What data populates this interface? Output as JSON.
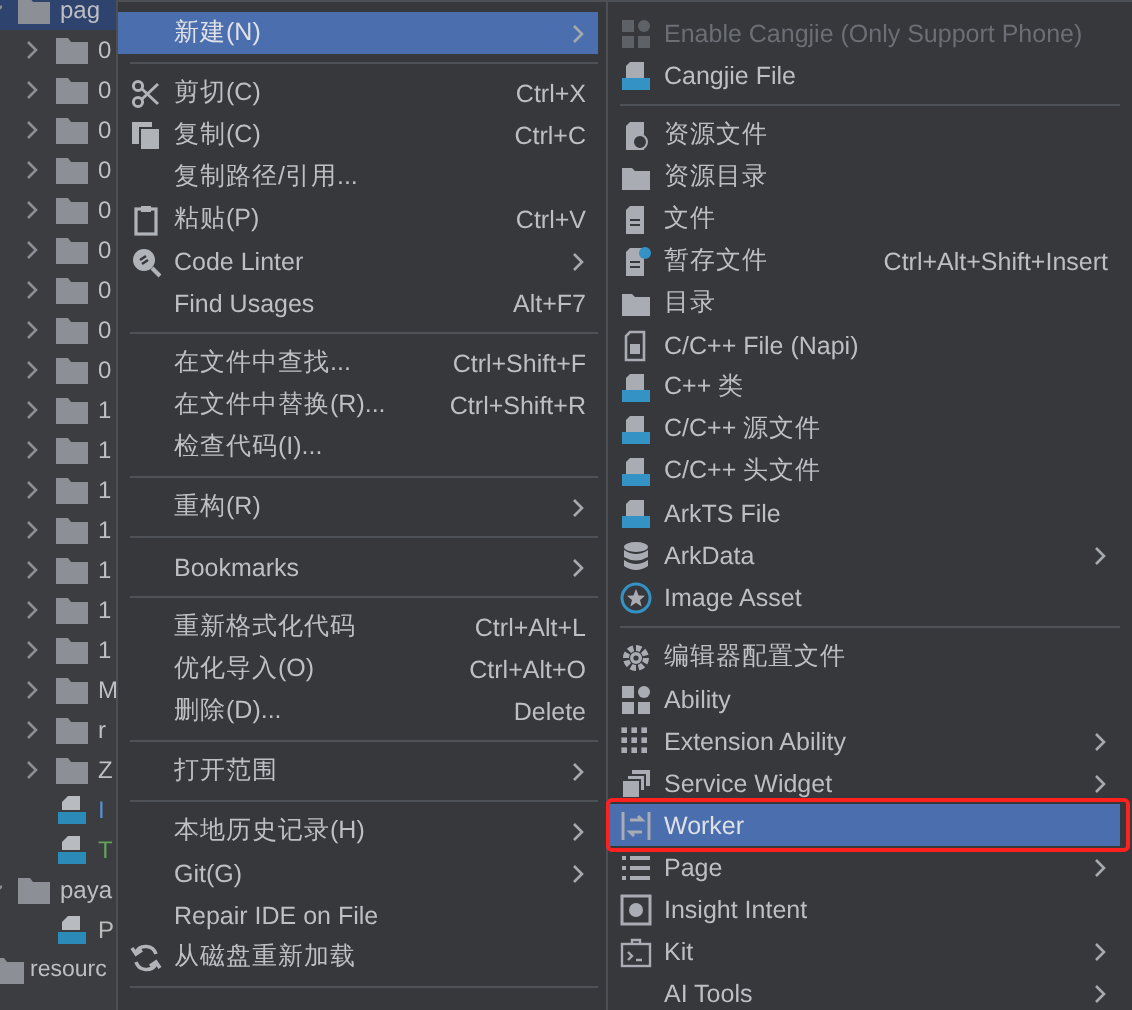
{
  "tree": {
    "items": [
      {
        "kind": "folder",
        "label": "pag",
        "expanded": true,
        "selected": true,
        "children": [
          {
            "kind": "folder",
            "label": "0",
            "expanded": false,
            "selected": false
          },
          {
            "kind": "folder",
            "label": "0",
            "expanded": false,
            "selected": false
          },
          {
            "kind": "folder",
            "label": "0",
            "expanded": false,
            "selected": false
          },
          {
            "kind": "folder",
            "label": "0",
            "expanded": false,
            "selected": false
          },
          {
            "kind": "folder",
            "label": "0",
            "expanded": false,
            "selected": false
          },
          {
            "kind": "folder",
            "label": "0",
            "expanded": false,
            "selected": false
          },
          {
            "kind": "folder",
            "label": "0",
            "expanded": false,
            "selected": false
          },
          {
            "kind": "folder",
            "label": "0",
            "expanded": false,
            "selected": false
          },
          {
            "kind": "folder",
            "label": "0",
            "expanded": false,
            "selected": false
          },
          {
            "kind": "folder",
            "label": "1",
            "expanded": false,
            "selected": false
          },
          {
            "kind": "folder",
            "label": "1",
            "expanded": false,
            "selected": false
          },
          {
            "kind": "folder",
            "label": "1",
            "expanded": false,
            "selected": false
          },
          {
            "kind": "folder",
            "label": "1",
            "expanded": false,
            "selected": false
          },
          {
            "kind": "folder",
            "label": "1",
            "expanded": false,
            "selected": false
          },
          {
            "kind": "folder",
            "label": "1",
            "expanded": false,
            "selected": false
          },
          {
            "kind": "folder",
            "label": "1",
            "expanded": false,
            "selected": false
          },
          {
            "kind": "folder",
            "label": "M",
            "expanded": false,
            "selected": false
          },
          {
            "kind": "folder",
            "label": "r",
            "expanded": false,
            "selected": false
          },
          {
            "kind": "folder",
            "label": "Z",
            "expanded": false,
            "selected": false
          },
          {
            "kind": "ets",
            "label": "I",
            "selected": false,
            "color": "#5a8fd8"
          },
          {
            "kind": "ets",
            "label": "T",
            "selected": false,
            "color": "#62a35a"
          }
        ]
      },
      {
        "kind": "folder",
        "label": "paya",
        "expanded": true,
        "selected": false,
        "children": [
          {
            "kind": "ets",
            "label": "P",
            "selected": false,
            "color": "#bbbbbb"
          }
        ]
      }
    ],
    "outer_items": [
      {
        "kind": "folder",
        "label": "resourc",
        "selected": false
      }
    ]
  },
  "context_menu": {
    "items": [
      {
        "kind": "item",
        "label": "新建(N)",
        "submenu": true,
        "selected": true
      },
      {
        "kind": "separator"
      },
      {
        "kind": "item",
        "label": "剪切(C)",
        "shortcut": "Ctrl+X",
        "submenu": false,
        "selected": false
      },
      {
        "kind": "item",
        "label": "复制(C)",
        "shortcut": "Ctrl+C",
        "submenu": false,
        "selected": false
      },
      {
        "kind": "item",
        "label": "复制路径/引用...",
        "submenu": false,
        "selected": false
      },
      {
        "kind": "item",
        "label": "粘贴(P)",
        "shortcut": "Ctrl+V",
        "submenu": false,
        "selected": false
      },
      {
        "kind": "item",
        "label": "Code Linter",
        "submenu": true,
        "selected": false
      },
      {
        "kind": "item",
        "label": "Find Usages",
        "shortcut": "Alt+F7",
        "submenu": false,
        "selected": false
      },
      {
        "kind": "separator"
      },
      {
        "kind": "item",
        "label": "在文件中查找...",
        "shortcut": "Ctrl+Shift+F",
        "submenu": false,
        "selected": false
      },
      {
        "kind": "item",
        "label": "在文件中替换(R)...",
        "shortcut": "Ctrl+Shift+R",
        "submenu": false,
        "selected": false
      },
      {
        "kind": "item",
        "label": "检查代码(I)...",
        "submenu": false,
        "selected": false
      },
      {
        "kind": "separator"
      },
      {
        "kind": "item",
        "label": "重构(R)",
        "submenu": true,
        "selected": false
      },
      {
        "kind": "separator"
      },
      {
        "kind": "item",
        "label": "Bookmarks",
        "submenu": true,
        "selected": false
      },
      {
        "kind": "separator"
      },
      {
        "kind": "item",
        "label": "重新格式化代码",
        "shortcut": "Ctrl+Alt+L",
        "submenu": false,
        "selected": false
      },
      {
        "kind": "item",
        "label": "优化导入(O)",
        "shortcut": "Ctrl+Alt+O",
        "submenu": false,
        "selected": false
      },
      {
        "kind": "item",
        "label": "删除(D)...",
        "shortcut": "Delete",
        "submenu": false,
        "selected": false
      },
      {
        "kind": "separator"
      },
      {
        "kind": "item",
        "label": "打开范围",
        "submenu": true,
        "selected": false
      },
      {
        "kind": "separator"
      },
      {
        "kind": "item",
        "label": "本地历史记录(H)",
        "submenu": true,
        "selected": false
      },
      {
        "kind": "item",
        "label": "Git(G)",
        "submenu": true,
        "selected": false
      },
      {
        "kind": "item",
        "label": "Repair IDE on File",
        "submenu": false,
        "selected": false
      },
      {
        "kind": "item",
        "label": "从磁盘重新加载",
        "submenu": false,
        "selected": false
      },
      {
        "kind": "separator"
      }
    ]
  },
  "new_submenu": {
    "items": [
      {
        "kind": "item",
        "label": "Enable Cangjie (Only Support Phone)",
        "submenu": false,
        "selected": false,
        "disabled": true,
        "annotated": false
      },
      {
        "kind": "item",
        "label": "Cangjie File",
        "submenu": false,
        "selected": false,
        "disabled": false,
        "annotated": false
      },
      {
        "kind": "separator"
      },
      {
        "kind": "item",
        "label": "资源文件",
        "submenu": false,
        "selected": false,
        "disabled": false,
        "annotated": false
      },
      {
        "kind": "item",
        "label": "资源目录",
        "submenu": false,
        "selected": false,
        "disabled": false,
        "annotated": false
      },
      {
        "kind": "item",
        "label": "文件",
        "submenu": false,
        "selected": false,
        "disabled": false,
        "annotated": false
      },
      {
        "kind": "item",
        "label": "暂存文件",
        "shortcut": "Ctrl+Alt+Shift+Insert",
        "submenu": false,
        "selected": false,
        "disabled": false,
        "annotated": false
      },
      {
        "kind": "item",
        "label": "目录",
        "submenu": false,
        "selected": false,
        "disabled": false,
        "annotated": false
      },
      {
        "kind": "item",
        "label": "C/C++ File (Napi)",
        "submenu": false,
        "selected": false,
        "disabled": false,
        "annotated": false
      },
      {
        "kind": "item",
        "label": "C++ 类",
        "submenu": false,
        "selected": false,
        "disabled": false,
        "annotated": false
      },
      {
        "kind": "item",
        "label": "C/C++ 源文件",
        "submenu": false,
        "selected": false,
        "disabled": false,
        "annotated": false
      },
      {
        "kind": "item",
        "label": "C/C++ 头文件",
        "submenu": false,
        "selected": false,
        "disabled": false,
        "annotated": false
      },
      {
        "kind": "item",
        "label": "ArkTS File",
        "submenu": false,
        "selected": false,
        "disabled": false,
        "annotated": false
      },
      {
        "kind": "item",
        "label": "ArkData",
        "submenu": true,
        "selected": false,
        "disabled": false,
        "annotated": false
      },
      {
        "kind": "item",
        "label": "Image Asset",
        "submenu": false,
        "selected": false,
        "disabled": false,
        "annotated": false
      },
      {
        "kind": "separator"
      },
      {
        "kind": "item",
        "label": "编辑器配置文件",
        "submenu": false,
        "selected": false,
        "disabled": false,
        "annotated": false
      },
      {
        "kind": "item",
        "label": "Ability",
        "submenu": false,
        "selected": false,
        "disabled": false,
        "annotated": false
      },
      {
        "kind": "item",
        "label": "Extension Ability",
        "submenu": true,
        "selected": false,
        "disabled": false,
        "annotated": false
      },
      {
        "kind": "item",
        "label": "Service Widget",
        "submenu": true,
        "selected": false,
        "disabled": false,
        "annotated": false
      },
      {
        "kind": "item",
        "label": "Worker",
        "submenu": false,
        "selected": true,
        "disabled": false,
        "annotated": true
      },
      {
        "kind": "item",
        "label": "Page",
        "submenu": true,
        "selected": false,
        "disabled": false,
        "annotated": false
      },
      {
        "kind": "item",
        "label": "Insight Intent",
        "submenu": false,
        "selected": false,
        "disabled": false,
        "annotated": false
      },
      {
        "kind": "item",
        "label": "Kit",
        "submenu": true,
        "selected": false,
        "disabled": false,
        "annotated": false
      },
      {
        "kind": "item",
        "label": "AI Tools",
        "submenu": true,
        "selected": false,
        "disabled": false,
        "annotated": false
      }
    ]
  }
}
